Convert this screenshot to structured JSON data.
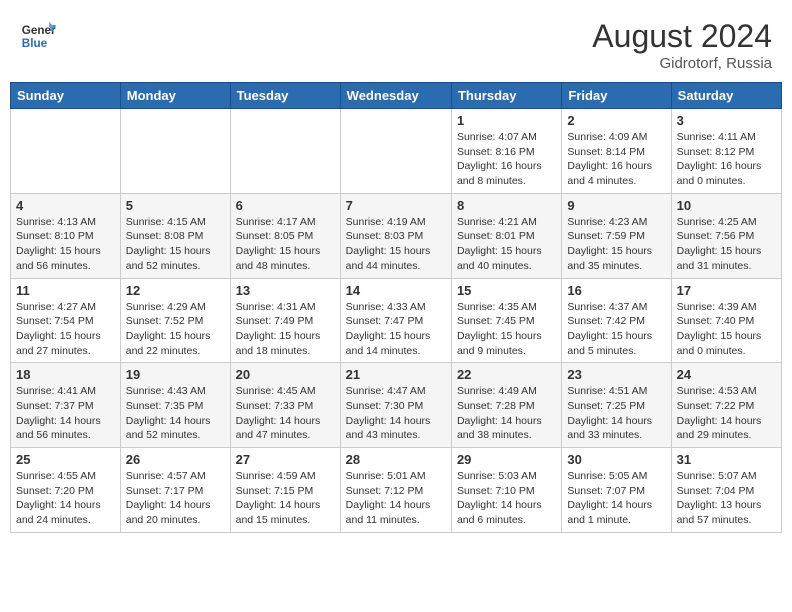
{
  "header": {
    "logo_line1": "General",
    "logo_line2": "Blue",
    "month_year": "August 2024",
    "location": "Gidrotorf, Russia"
  },
  "days_of_week": [
    "Sunday",
    "Monday",
    "Tuesday",
    "Wednesday",
    "Thursday",
    "Friday",
    "Saturday"
  ],
  "weeks": [
    [
      {
        "day": "",
        "info": ""
      },
      {
        "day": "",
        "info": ""
      },
      {
        "day": "",
        "info": ""
      },
      {
        "day": "",
        "info": ""
      },
      {
        "day": "1",
        "info": "Sunrise: 4:07 AM\nSunset: 8:16 PM\nDaylight: 16 hours\nand 8 minutes."
      },
      {
        "day": "2",
        "info": "Sunrise: 4:09 AM\nSunset: 8:14 PM\nDaylight: 16 hours\nand 4 minutes."
      },
      {
        "day": "3",
        "info": "Sunrise: 4:11 AM\nSunset: 8:12 PM\nDaylight: 16 hours\nand 0 minutes."
      }
    ],
    [
      {
        "day": "4",
        "info": "Sunrise: 4:13 AM\nSunset: 8:10 PM\nDaylight: 15 hours\nand 56 minutes."
      },
      {
        "day": "5",
        "info": "Sunrise: 4:15 AM\nSunset: 8:08 PM\nDaylight: 15 hours\nand 52 minutes."
      },
      {
        "day": "6",
        "info": "Sunrise: 4:17 AM\nSunset: 8:05 PM\nDaylight: 15 hours\nand 48 minutes."
      },
      {
        "day": "7",
        "info": "Sunrise: 4:19 AM\nSunset: 8:03 PM\nDaylight: 15 hours\nand 44 minutes."
      },
      {
        "day": "8",
        "info": "Sunrise: 4:21 AM\nSunset: 8:01 PM\nDaylight: 15 hours\nand 40 minutes."
      },
      {
        "day": "9",
        "info": "Sunrise: 4:23 AM\nSunset: 7:59 PM\nDaylight: 15 hours\nand 35 minutes."
      },
      {
        "day": "10",
        "info": "Sunrise: 4:25 AM\nSunset: 7:56 PM\nDaylight: 15 hours\nand 31 minutes."
      }
    ],
    [
      {
        "day": "11",
        "info": "Sunrise: 4:27 AM\nSunset: 7:54 PM\nDaylight: 15 hours\nand 27 minutes."
      },
      {
        "day": "12",
        "info": "Sunrise: 4:29 AM\nSunset: 7:52 PM\nDaylight: 15 hours\nand 22 minutes."
      },
      {
        "day": "13",
        "info": "Sunrise: 4:31 AM\nSunset: 7:49 PM\nDaylight: 15 hours\nand 18 minutes."
      },
      {
        "day": "14",
        "info": "Sunrise: 4:33 AM\nSunset: 7:47 PM\nDaylight: 15 hours\nand 14 minutes."
      },
      {
        "day": "15",
        "info": "Sunrise: 4:35 AM\nSunset: 7:45 PM\nDaylight: 15 hours\nand 9 minutes."
      },
      {
        "day": "16",
        "info": "Sunrise: 4:37 AM\nSunset: 7:42 PM\nDaylight: 15 hours\nand 5 minutes."
      },
      {
        "day": "17",
        "info": "Sunrise: 4:39 AM\nSunset: 7:40 PM\nDaylight: 15 hours\nand 0 minutes."
      }
    ],
    [
      {
        "day": "18",
        "info": "Sunrise: 4:41 AM\nSunset: 7:37 PM\nDaylight: 14 hours\nand 56 minutes."
      },
      {
        "day": "19",
        "info": "Sunrise: 4:43 AM\nSunset: 7:35 PM\nDaylight: 14 hours\nand 52 minutes."
      },
      {
        "day": "20",
        "info": "Sunrise: 4:45 AM\nSunset: 7:33 PM\nDaylight: 14 hours\nand 47 minutes."
      },
      {
        "day": "21",
        "info": "Sunrise: 4:47 AM\nSunset: 7:30 PM\nDaylight: 14 hours\nand 43 minutes."
      },
      {
        "day": "22",
        "info": "Sunrise: 4:49 AM\nSunset: 7:28 PM\nDaylight: 14 hours\nand 38 minutes."
      },
      {
        "day": "23",
        "info": "Sunrise: 4:51 AM\nSunset: 7:25 PM\nDaylight: 14 hours\nand 33 minutes."
      },
      {
        "day": "24",
        "info": "Sunrise: 4:53 AM\nSunset: 7:22 PM\nDaylight: 14 hours\nand 29 minutes."
      }
    ],
    [
      {
        "day": "25",
        "info": "Sunrise: 4:55 AM\nSunset: 7:20 PM\nDaylight: 14 hours\nand 24 minutes."
      },
      {
        "day": "26",
        "info": "Sunrise: 4:57 AM\nSunset: 7:17 PM\nDaylight: 14 hours\nand 20 minutes."
      },
      {
        "day": "27",
        "info": "Sunrise: 4:59 AM\nSunset: 7:15 PM\nDaylight: 14 hours\nand 15 minutes."
      },
      {
        "day": "28",
        "info": "Sunrise: 5:01 AM\nSunset: 7:12 PM\nDaylight: 14 hours\nand 11 minutes."
      },
      {
        "day": "29",
        "info": "Sunrise: 5:03 AM\nSunset: 7:10 PM\nDaylight: 14 hours\nand 6 minutes."
      },
      {
        "day": "30",
        "info": "Sunrise: 5:05 AM\nSunset: 7:07 PM\nDaylight: 14 hours\nand 1 minute."
      },
      {
        "day": "31",
        "info": "Sunrise: 5:07 AM\nSunset: 7:04 PM\nDaylight: 13 hours\nand 57 minutes."
      }
    ]
  ]
}
